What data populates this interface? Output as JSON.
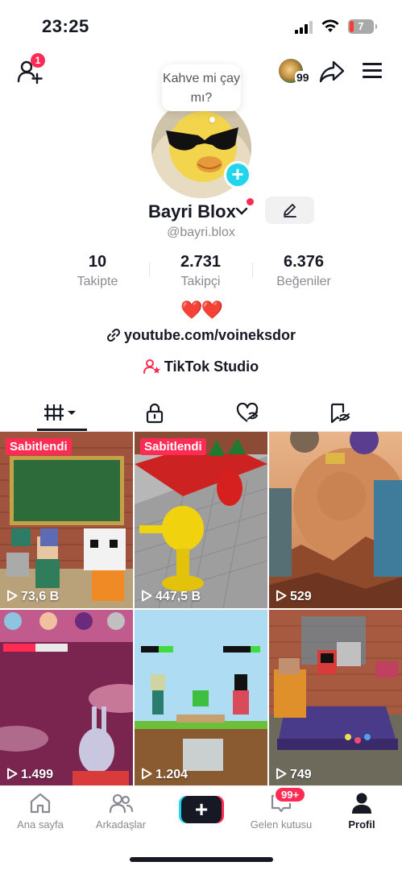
{
  "status": {
    "time": "23:25",
    "battery": "7"
  },
  "header": {
    "add_friend_badge": "1",
    "mini_avatar_count": "99"
  },
  "profile": {
    "speech_bubble": "Kahve mi çay mı?",
    "display_name": "Bayri Blox",
    "handle": "@bayri.blox",
    "stats": [
      {
        "value": "10",
        "label": "Takipte"
      },
      {
        "value": "2.731",
        "label": "Takipçi"
      },
      {
        "value": "6.376",
        "label": "Beğeniler"
      }
    ],
    "bio": "❤️❤️",
    "link": "youtube.com/voineksdor",
    "studio": "TikTok Studio"
  },
  "videos": [
    {
      "pinned": "Sabitlendi",
      "views": "73,6 B"
    },
    {
      "pinned": "Sabitlendi",
      "views": "447,5 B"
    },
    {
      "views": "529"
    },
    {
      "views": "1.499"
    },
    {
      "views": "1.204"
    },
    {
      "views": "749"
    }
  ],
  "nav": {
    "home": "Ana sayfa",
    "friends": "Arkadaşlar",
    "inbox": "Gelen kutusu",
    "inbox_badge": "99+",
    "profile": "Profil"
  },
  "colors": {
    "accent": "#fe2c55",
    "cyan": "#20d5ec",
    "text": "#161823",
    "muted": "#8a8b91"
  }
}
